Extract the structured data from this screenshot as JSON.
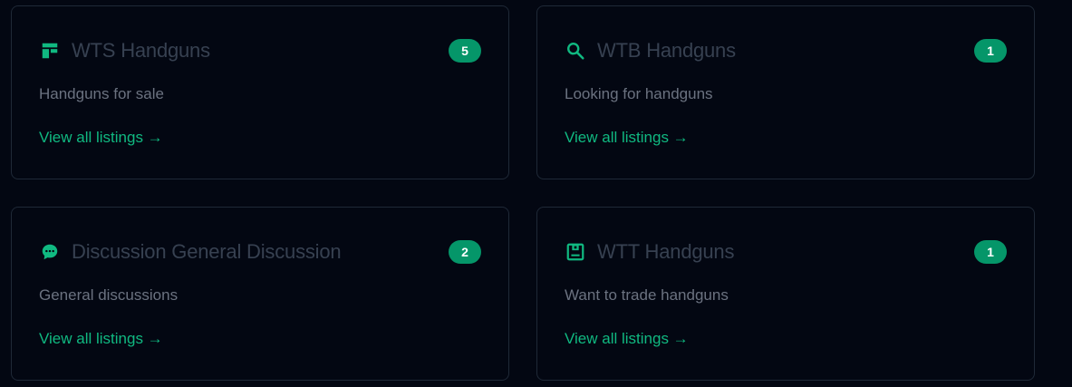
{
  "colors": {
    "background": "#030712",
    "card_border": "#1f2937",
    "accent": "#10b981",
    "badge_bg": "#059669",
    "title": "#374151",
    "description": "#6b7280"
  },
  "categories": [
    {
      "icon": "layout-icon",
      "title": "WTS Handguns",
      "count": "5",
      "description": "Handguns for sale",
      "link": "View all listings →"
    },
    {
      "icon": "search-icon",
      "title": "WTB Handguns",
      "count": "1",
      "description": "Looking for handguns",
      "link": "View all listings →"
    },
    {
      "icon": "chat-icon",
      "title": "Discussion General Discussion",
      "count": "2",
      "description": "General discussions",
      "link": "View all listings →"
    },
    {
      "icon": "trade-box-icon",
      "title": "WTT Handguns",
      "count": "1",
      "description": "Want to trade handguns",
      "link": "View all listings →"
    }
  ]
}
